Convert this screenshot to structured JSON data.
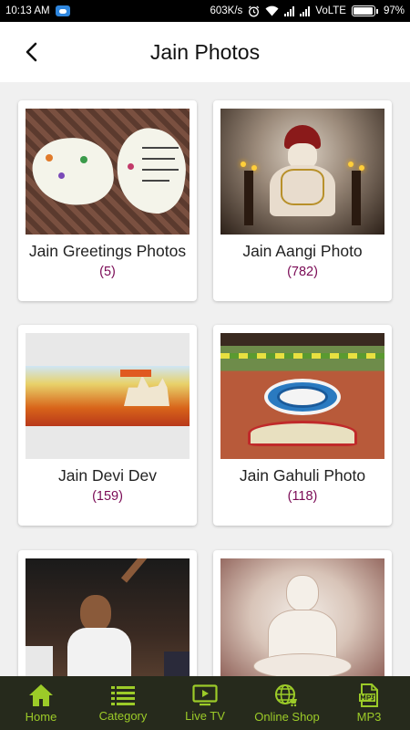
{
  "status_bar": {
    "time": "10:13 AM",
    "speed": "603K/s",
    "network": "VoLTE",
    "battery": "97%",
    "battery_level": 0.97
  },
  "header": {
    "title": "Jain Photos",
    "back_icon": "back-arrow-icon"
  },
  "categories": [
    {
      "title": "Jain Greetings Photos",
      "count": "(5)"
    },
    {
      "title": "Jain Aangi Photo",
      "count": "(782)"
    },
    {
      "title": "Jain Devi Dev",
      "count": "(159)"
    },
    {
      "title": "Jain Gahuli Photo",
      "count": "(118)"
    },
    {
      "title": "",
      "count": ""
    },
    {
      "title": "",
      "count": ""
    }
  ],
  "bottom_nav": [
    {
      "label": "Home",
      "icon": "home-icon"
    },
    {
      "label": "Category",
      "icon": "list-icon"
    },
    {
      "label": "Live TV",
      "icon": "tv-icon"
    },
    {
      "label": "Online Shop",
      "icon": "globe-icon"
    },
    {
      "label": "MP3",
      "icon": "mp3-file-icon"
    }
  ],
  "colors": {
    "nav_background": "#262a1c",
    "nav_accent": "#9ccb28",
    "count_color": "#7a0a55"
  }
}
